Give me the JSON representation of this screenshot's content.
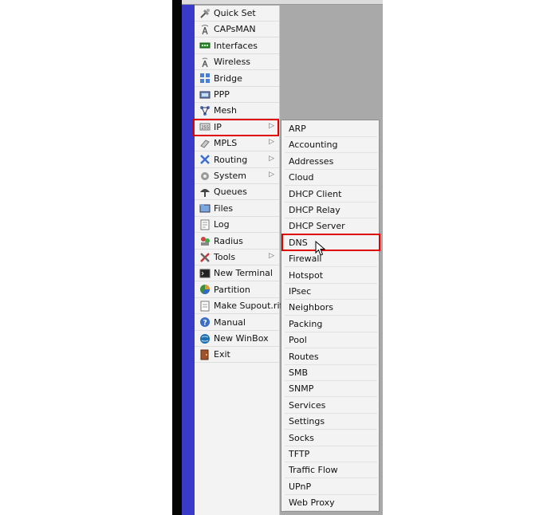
{
  "main_menu": {
    "items": [
      {
        "label": "Quick Set",
        "icon": "quick-set-icon",
        "has_submenu": false
      },
      {
        "label": "CAPsMAN",
        "icon": "capsman-icon",
        "has_submenu": false
      },
      {
        "label": "Interfaces",
        "icon": "interfaces-icon",
        "has_submenu": false
      },
      {
        "label": "Wireless",
        "icon": "wireless-icon",
        "has_submenu": false
      },
      {
        "label": "Bridge",
        "icon": "bridge-icon",
        "has_submenu": false
      },
      {
        "label": "PPP",
        "icon": "ppp-icon",
        "has_submenu": false
      },
      {
        "label": "Mesh",
        "icon": "mesh-icon",
        "has_submenu": false
      },
      {
        "label": "IP",
        "icon": "ip-icon",
        "has_submenu": true
      },
      {
        "label": "MPLS",
        "icon": "mpls-icon",
        "has_submenu": true
      },
      {
        "label": "Routing",
        "icon": "routing-icon",
        "has_submenu": true
      },
      {
        "label": "System",
        "icon": "system-icon",
        "has_submenu": true
      },
      {
        "label": "Queues",
        "icon": "queues-icon",
        "has_submenu": false
      },
      {
        "label": "Files",
        "icon": "files-icon",
        "has_submenu": false
      },
      {
        "label": "Log",
        "icon": "log-icon",
        "has_submenu": false
      },
      {
        "label": "Radius",
        "icon": "radius-icon",
        "has_submenu": false
      },
      {
        "label": "Tools",
        "icon": "tools-icon",
        "has_submenu": true
      },
      {
        "label": "New Terminal",
        "icon": "terminal-icon",
        "has_submenu": false
      },
      {
        "label": "Partition",
        "icon": "partition-icon",
        "has_submenu": false
      },
      {
        "label": "Make Supout.rif",
        "icon": "supout-icon",
        "has_submenu": false
      },
      {
        "label": "Manual",
        "icon": "manual-icon",
        "has_submenu": false
      },
      {
        "label": "New WinBox",
        "icon": "winbox-icon",
        "has_submenu": false
      },
      {
        "label": "Exit",
        "icon": "exit-icon",
        "has_submenu": false
      }
    ],
    "submenu_arrow": "▷"
  },
  "ip_submenu": {
    "items": [
      "ARP",
      "Accounting",
      "Addresses",
      "Cloud",
      "DHCP Client",
      "DHCP Relay",
      "DHCP Server",
      "DNS",
      "Firewall",
      "Hotspot",
      "IPsec",
      "Neighbors",
      "Packing",
      "Pool",
      "Routes",
      "SMB",
      "SNMP",
      "Services",
      "Settings",
      "Socks",
      "TFTP",
      "Traffic Flow",
      "UPnP",
      "Web Proxy"
    ]
  },
  "highlight": {
    "main_item": "IP",
    "sub_item": "DNS",
    "color": "#e00000"
  },
  "colors": {
    "sidebar_blue": "#3a3ac8",
    "menu_bg": "#f3f3f3",
    "workspace_gray": "#a9a9a9"
  }
}
